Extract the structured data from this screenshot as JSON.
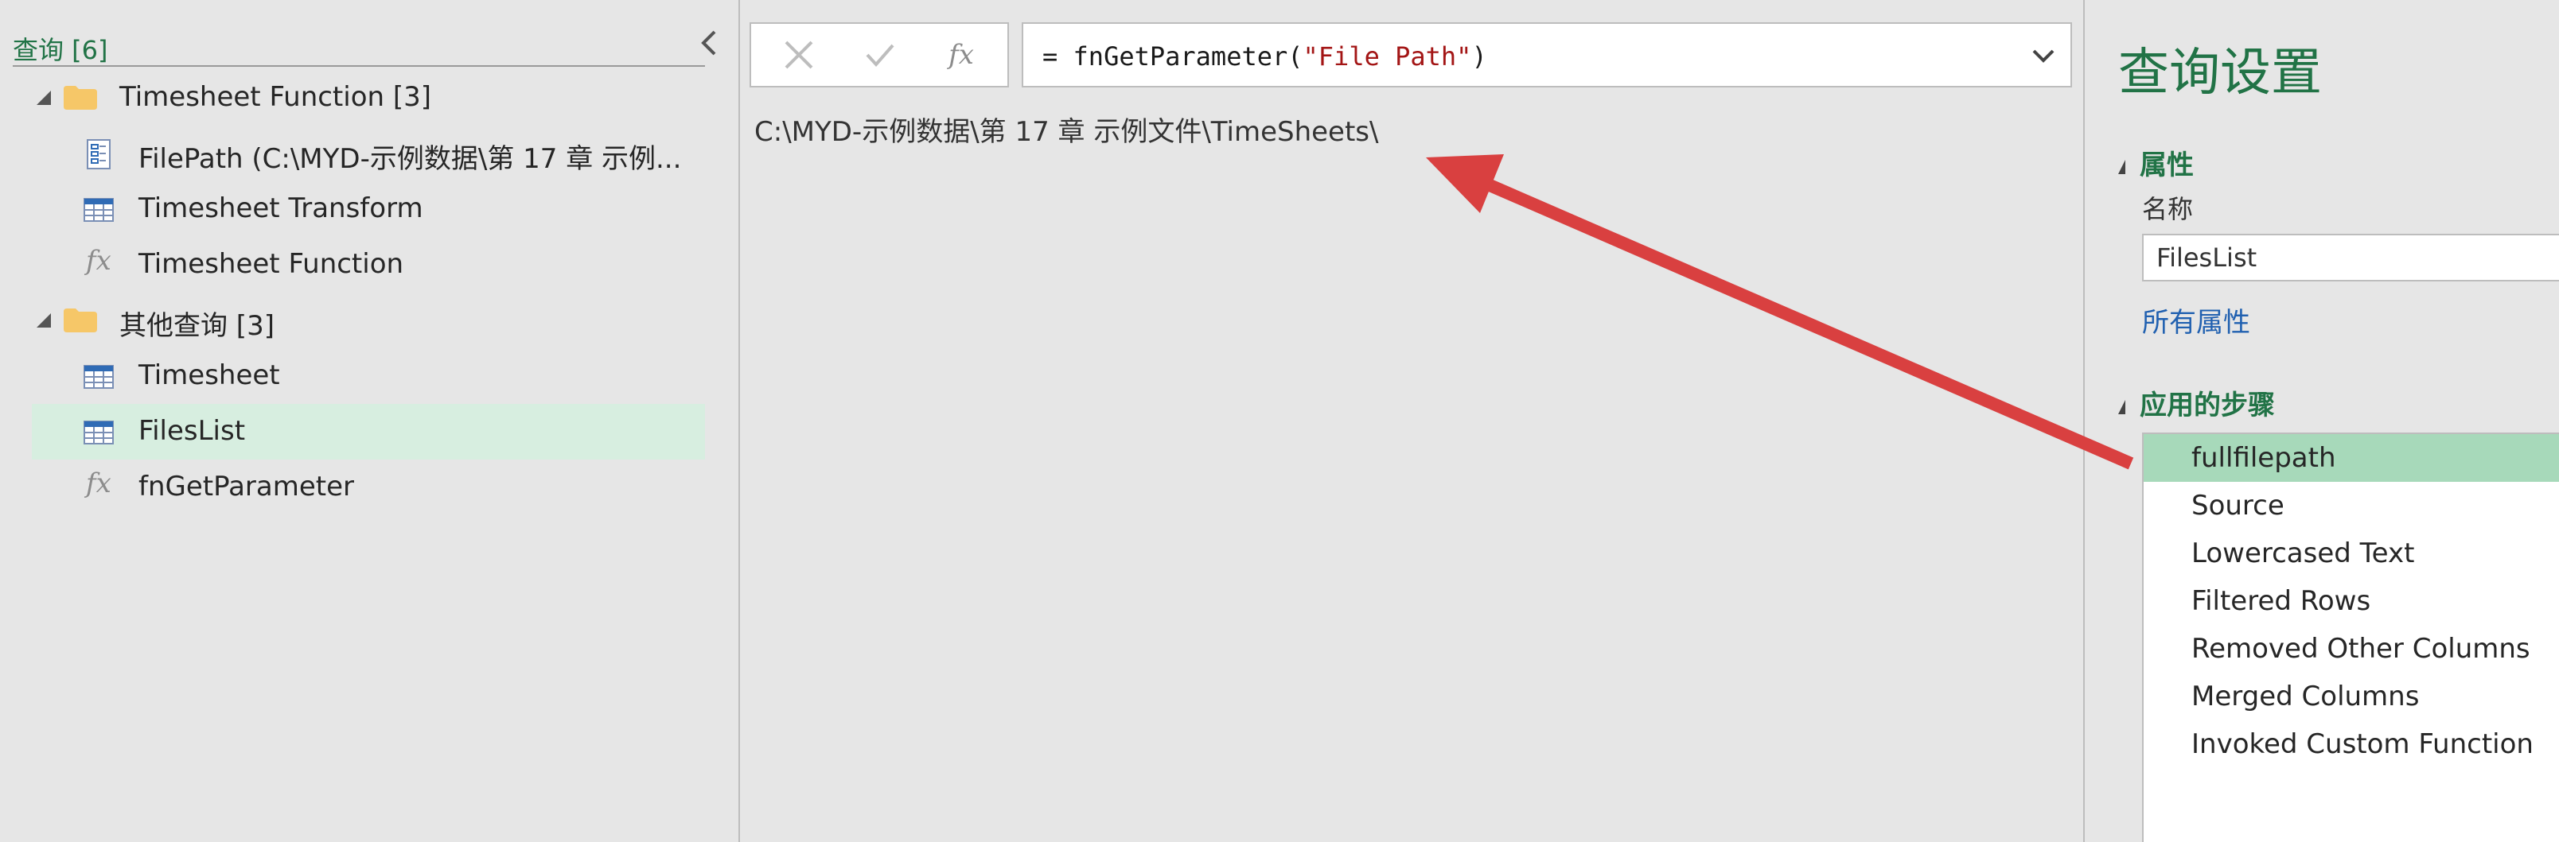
{
  "queries_pane": {
    "title": "查询 [6]",
    "groups": [
      {
        "label": "Timesheet Function [3]",
        "items": [
          {
            "label": "FilePath (C:\\MYD-示例数据\\第 17 章 示例...",
            "icon": "parameter-icon"
          },
          {
            "label": "Timesheet Transform",
            "icon": "table-icon"
          },
          {
            "label": "Timesheet Function",
            "icon": "function-icon"
          }
        ]
      },
      {
        "label": "其他查询 [3]",
        "items": [
          {
            "label": "Timesheet",
            "icon": "table-icon"
          },
          {
            "label": "FilesList",
            "icon": "table-icon",
            "selected": true
          },
          {
            "label": "fnGetParameter",
            "icon": "function-icon"
          }
        ]
      }
    ]
  },
  "formula_bar": {
    "fx_label": "fx",
    "prefix": "= fnGetParameter(",
    "string_arg": "\"File Path\"",
    "suffix": ")"
  },
  "preview": {
    "value": "C:\\MYD-示例数据\\第 17 章 示例文件\\TimeSheets\\"
  },
  "settings": {
    "title": "查询设置",
    "properties_header": "属性",
    "name_label": "名称",
    "name_value": "FilesList",
    "all_properties_link": "所有属性",
    "applied_steps_header": "应用的步骤",
    "steps": [
      {
        "label": "fullfilepath",
        "selected": true
      },
      {
        "label": "Source"
      },
      {
        "label": "Lowercased Text"
      },
      {
        "label": "Filtered Rows"
      },
      {
        "label": "Removed Other Columns"
      },
      {
        "label": "Merged Columns"
      },
      {
        "label": "Invoked Custom Function"
      }
    ]
  },
  "colors": {
    "accent_green": "#217346",
    "selected_query": "#d7eee0",
    "selected_step": "#a7d9ba",
    "annotation_arrow": "#d94040",
    "link_blue": "#2060b0"
  }
}
